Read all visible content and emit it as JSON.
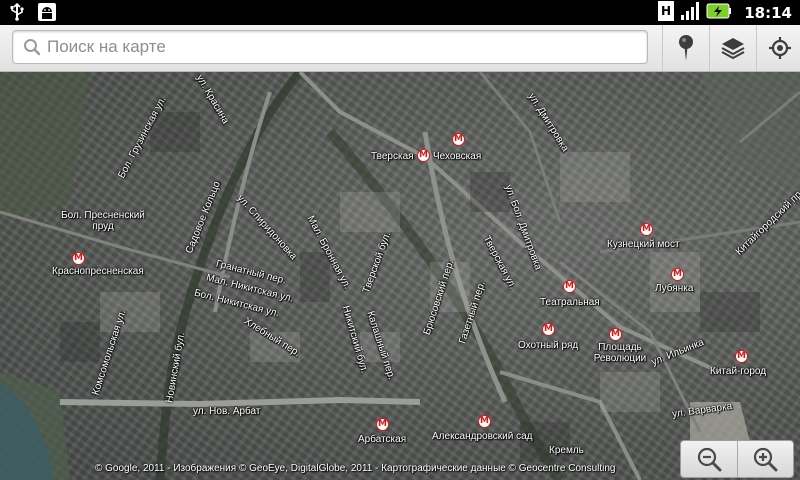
{
  "status_bar": {
    "time": "18:14",
    "left_icons": [
      "usb-icon",
      "android-debug-icon"
    ],
    "right_icons": [
      "hspa-icon",
      "signal-icon",
      "battery-charging-icon"
    ]
  },
  "search": {
    "placeholder": "Поиск на карте"
  },
  "toolbar": {
    "buttons": [
      "place-marker-icon",
      "layers-icon",
      "my-location-icon"
    ]
  },
  "map": {
    "streets": [
      "Бол. Грузинская ул.",
      "ул. Красина",
      "ул. Дмитровка",
      "Бол. Пресненский пруд",
      "Садовое Кольцо",
      "ул. Спиридоновка",
      "Мал. Бронная ул.",
      "Тверской бул.",
      "ул. Бол. Дмитровка",
      "Тверская ул.",
      "Гранатный пер.",
      "Мал. Никитская ул.",
      "Бол. Никитская ул.",
      "Хлебный пер.",
      "Никитский бул.",
      "Калашный пер.",
      "Брюсовский пер.",
      "Газетный пер.",
      "Комсомольская ул.",
      "Новинский бул.",
      "ул. Нов. Арбат",
      "ул. Ильинка",
      "ул. Варварка",
      "Китайгородский пр."
    ],
    "stations": [
      "Тверская",
      "Чеховская",
      "Краснопресненская",
      "Кузнецкий мост",
      "Лубянка",
      "Театральная",
      "Охотный ряд",
      "Площадь Революции",
      "Китай-город",
      "Арбатская",
      "Александровский сад",
      "Кремль"
    ],
    "metro_symbol": "M",
    "copyright": "© Google, 2011 - Изображения © GeoEye, DigitalGlobe, 2011 - Картографические данные © Geocentre Consulting"
  },
  "zoom": {
    "out_icon": "zoom-out-icon",
    "in_icon": "zoom-in-icon"
  },
  "colors": {
    "accent_battery": "#7cd02a",
    "metro_red": "#d31b1b"
  }
}
